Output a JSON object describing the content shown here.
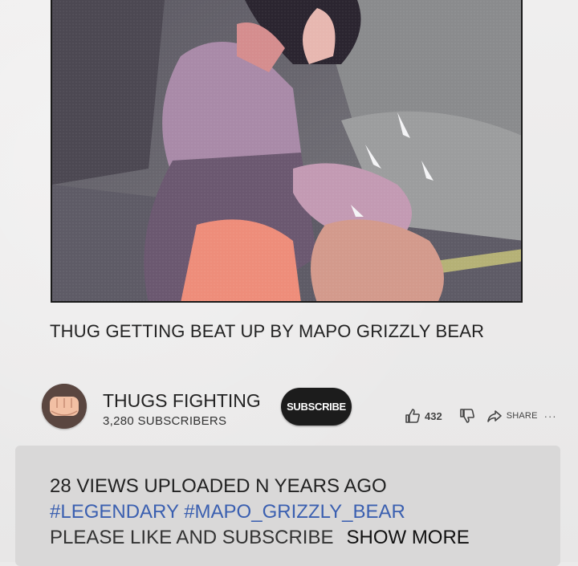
{
  "video": {
    "title": "THUG GETTING BEAT UP BY MAPO GRIZZLY BEAR"
  },
  "channel": {
    "name": "THUGS FIGHTING",
    "subscribers": "3,280 SUBSCRIBERS",
    "subscribe_label": "SUBSCRIBE"
  },
  "actions": {
    "like_count": "432",
    "share_label": "SHARE",
    "more_label": "···"
  },
  "description": {
    "meta": "28 VIEWS UPLOADED N YEARS AGO",
    "tags": [
      "#LEGENDARY",
      "#MAPO_GRIZZLY_BEAR"
    ],
    "text": "PLEASE LIKE AND SUBSCRIBE",
    "show_more": "SHOW MORE"
  },
  "colors": {
    "tag_link": "#3a5fb0",
    "subscribe_bg": "#1c1c1c",
    "description_bg": "#d9d8d8"
  }
}
